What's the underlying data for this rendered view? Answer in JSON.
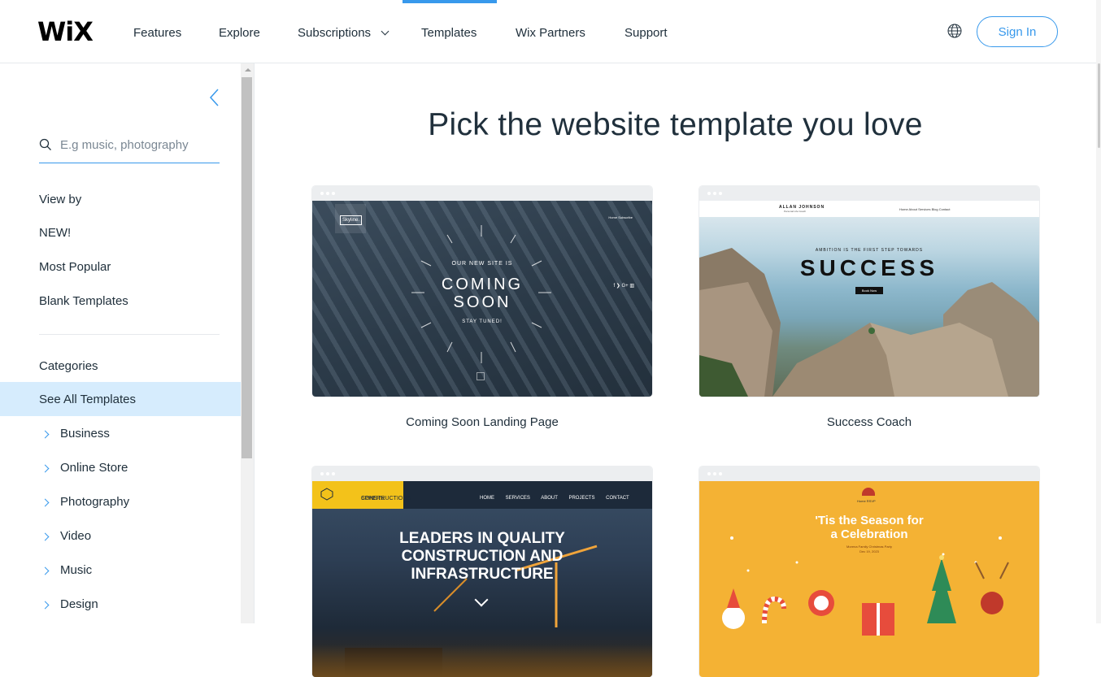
{
  "header": {
    "logo": "WiX",
    "nav": [
      {
        "label": "Features"
      },
      {
        "label": "Explore"
      },
      {
        "label": "Subscriptions"
      },
      {
        "label": "Templates"
      },
      {
        "label": "Wix Partners"
      },
      {
        "label": "Support"
      }
    ],
    "active_nav": "Templates",
    "sign_in": "Sign In",
    "accent_color": "#3899ec"
  },
  "sidebar": {
    "search_placeholder": "E.g music, photography",
    "view_by_label": "View by",
    "view_by": [
      "NEW!",
      "Most Popular",
      "Blank Templates"
    ],
    "categories_label": "Categories",
    "selected": "See All Templates",
    "categories": [
      "Business",
      "Online Store",
      "Photography",
      "Video",
      "Music",
      "Design"
    ]
  },
  "main": {
    "heading": "Pick the website template you love",
    "templates": [
      {
        "name": "Coming Soon Landing Page",
        "preview": {
          "logo": "Skyline.",
          "nav": "Home  Subscribe",
          "pre": "OUR NEW SITE IS",
          "title_line1": "COMING",
          "title_line2": "SOON",
          "post": "STAY TUNED!",
          "socials": "f ❯ G+ ▥"
        }
      },
      {
        "name": "Success Coach",
        "preview": {
          "brand": "ALLAN JOHNSON",
          "brand_sub": "Personal Life Coach",
          "nav": "Home   About   Services   Blog   Contact",
          "tagline": "AMBITION IS THE FIRST STEP TOWARDS",
          "title": "SUCCESS",
          "button": "Book Now"
        }
      },
      {
        "name": "",
        "preview": {
          "brand_line1": "SPHERE",
          "brand_line2": "CONSTRUCTIONS",
          "nav": "HOME SERVICES ABOUT PROJECTS CONTACT",
          "title_line1": "LEADERS IN QUALITY",
          "title_line2": "CONSTRUCTION AND",
          "title_line3": "INFRASTRUCTURE"
        }
      },
      {
        "name": "",
        "preview": {
          "nav": "Home    RSVP",
          "title_line1": "'Tis the Season for",
          "title_line2": "a Celebration",
          "sub_line1": "Morena Family Christmas Party",
          "sub_line2": "Dec 19, 2023"
        }
      }
    ]
  }
}
